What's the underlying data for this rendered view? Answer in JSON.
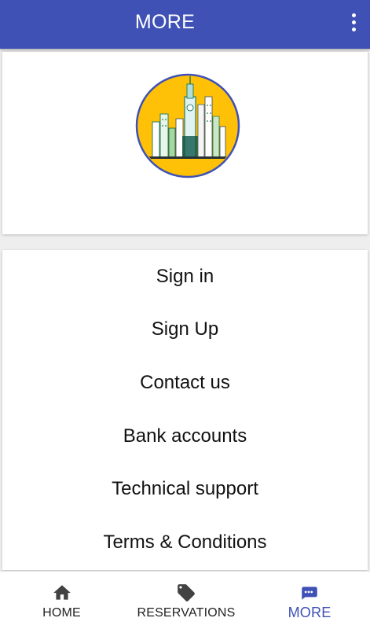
{
  "app_bar": {
    "title": "MORE",
    "menu_icon": "more-vert-icon",
    "color": "#3f51b5"
  },
  "logo": {
    "icon": "city-skyline-logo",
    "background_color": "#ffc107",
    "ring_color": "#3f51b5"
  },
  "menu": {
    "items": [
      {
        "label": "Sign in"
      },
      {
        "label": "Sign Up"
      },
      {
        "label": "Contact us"
      },
      {
        "label": "Bank accounts"
      },
      {
        "label": "Technical support"
      },
      {
        "label": "Terms & Conditions"
      }
    ]
  },
  "bottom_nav": {
    "active_color": "#3f51b5",
    "items": [
      {
        "label": "HOME",
        "icon": "home-icon",
        "active": false
      },
      {
        "label": "RESERVATIONS",
        "icon": "tag-icon",
        "active": false
      },
      {
        "label": "MORE",
        "icon": "chat-more-icon",
        "active": true
      }
    ]
  }
}
